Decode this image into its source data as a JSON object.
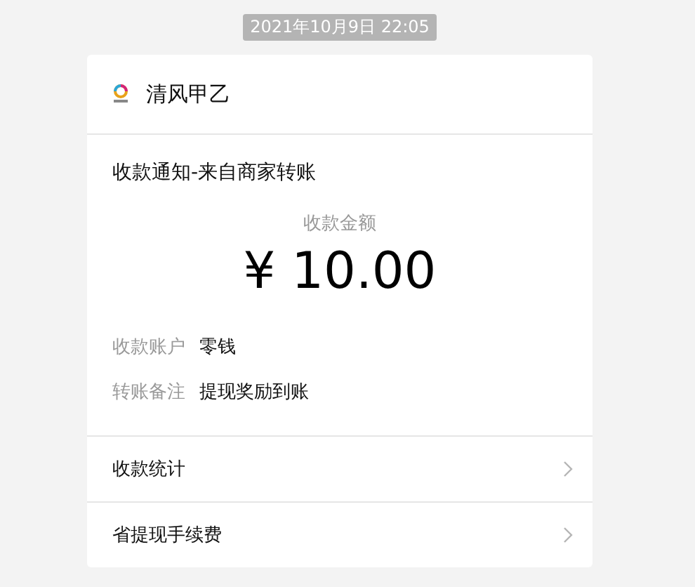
{
  "timestamp": "2021年10月9日 22:05",
  "sender": {
    "name": "清风甲乙"
  },
  "title": "收款通知-来自商家转账",
  "amount": {
    "label": "收款金额",
    "value": "¥ 10.00"
  },
  "details": [
    {
      "label": "收款账户",
      "value": "零钱"
    },
    {
      "label": "转账备注",
      "value": "提现奖励到账"
    }
  ],
  "links": [
    {
      "label": "收款统计"
    },
    {
      "label": "省提现手续费"
    }
  ]
}
